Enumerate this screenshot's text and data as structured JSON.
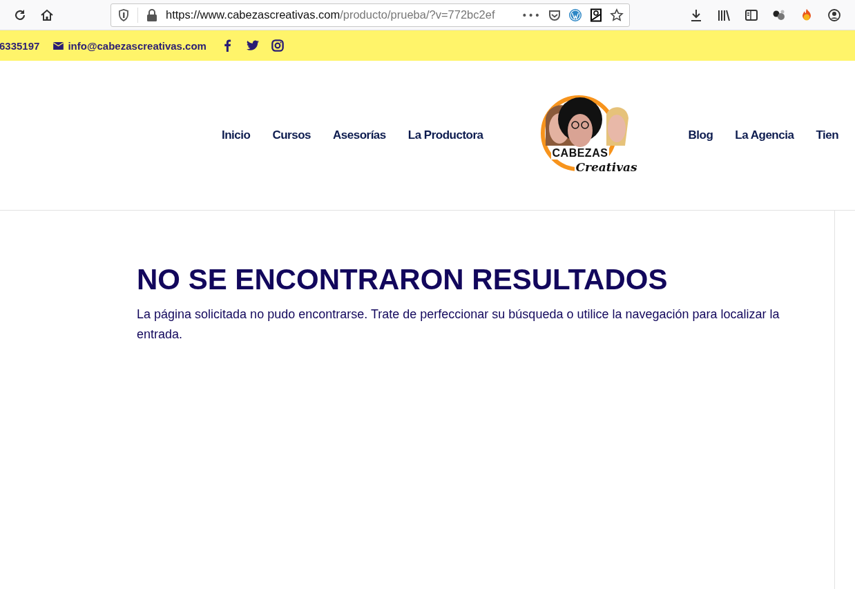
{
  "browser": {
    "url_host": "https://www.cabezascreativas.com",
    "url_path": "/producto/prueba/?v=772bc2ef",
    "more": "•••"
  },
  "topbar": {
    "phone": "6335197",
    "email": "info@cabezascreativas.com"
  },
  "nav_left": [
    "Inicio",
    "Cursos",
    "Asesorías",
    "La Productora"
  ],
  "logo": {
    "line1": "CABEZAS",
    "line2": "Creativas"
  },
  "nav_right": [
    "Blog",
    "La Agencia",
    "Tien"
  ],
  "content": {
    "title": "NO SE ENCONTRARON RESULTADOS",
    "message": "La página solicitada no pudo encontrarse. Trate de perfeccionar su búsqueda o utilice la navegación para localizar la entrada."
  }
}
